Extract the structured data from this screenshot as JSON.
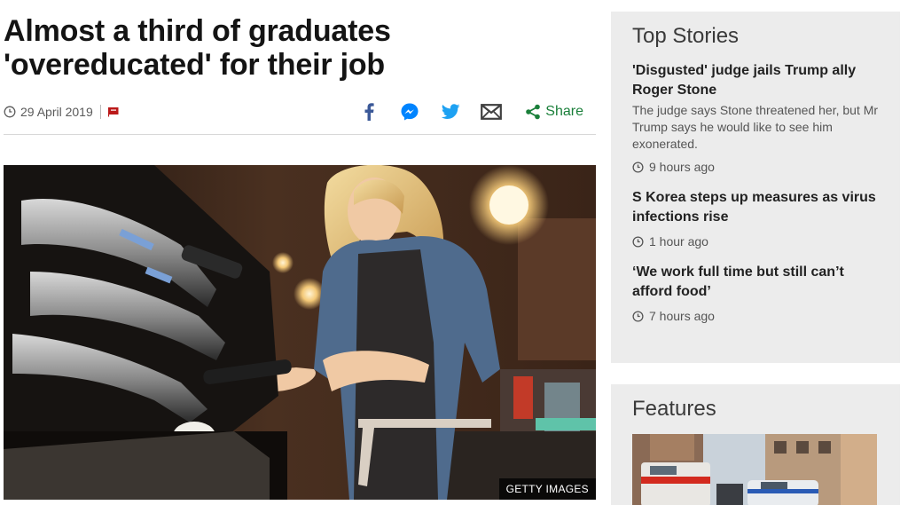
{
  "article": {
    "headline_line1": "Almost a third of graduates",
    "headline_line2": "'overeducated' for their job",
    "date": "29 April 2019",
    "share_label": "Share",
    "share_icons": [
      "facebook-icon",
      "messenger-icon",
      "twitter-icon",
      "email-icon",
      "share-icon"
    ],
    "image_credit": "GETTY IMAGES"
  },
  "top_stories": {
    "title": "Top Stories",
    "items": [
      {
        "title": "'Disgusted' judge jails Trump ally Roger Stone",
        "summary": "The judge says Stone threatened her, but Mr Trump says he would like to see him exonerated.",
        "time": "9 hours ago"
      },
      {
        "title": "S Korea steps up measures as virus infections rise",
        "summary": "",
        "time": "1 hour ago"
      },
      {
        "title": "‘We work full time but still can’t afford food’",
        "summary": "",
        "time": "7 hours ago"
      }
    ]
  },
  "features": {
    "title": "Features"
  },
  "colors": {
    "accent_red": "#bb1919",
    "share_green": "#1a7f3a",
    "facebook_blue": "#3b5998",
    "messenger_blue": "#0084ff",
    "twitter_blue": "#1da1f2",
    "panel_bg": "#ececec"
  }
}
